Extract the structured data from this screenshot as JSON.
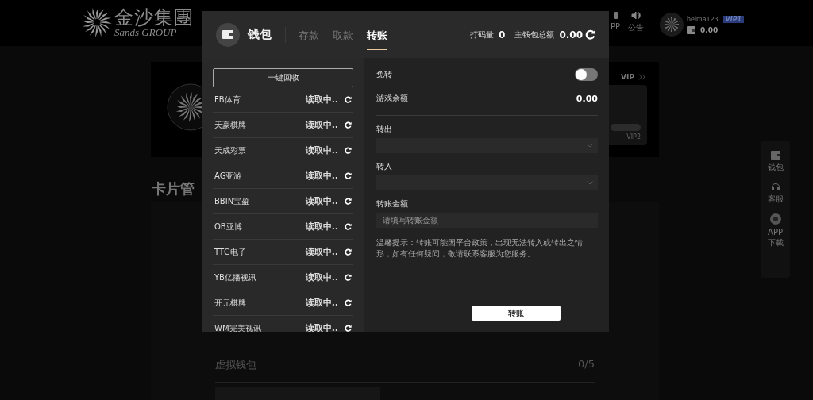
{
  "header": {
    "logo_cn": "金沙集團",
    "logo_en": "Sands GROUP",
    "nav": [
      {
        "label": "PP"
      },
      {
        "label": "公告"
      }
    ],
    "user": {
      "name": "heima123",
      "vip": "VIP1",
      "balance": "0.00"
    }
  },
  "profile_card": {
    "vip_link": "VIP",
    "next_level": "VIP2",
    "level": 0
  },
  "section_title": "卡片管",
  "virtual_wallet": {
    "title": "虚拟钱包",
    "count": "0/5"
  },
  "side_menu": [
    {
      "label": "钱包"
    },
    {
      "label": "客服"
    },
    {
      "label": "APP 下載"
    }
  ],
  "modal": {
    "title": "钱包",
    "tabs": [
      {
        "label": "存款",
        "selected": false
      },
      {
        "label": "取款",
        "selected": false
      },
      {
        "label": "转账",
        "selected": true
      }
    ],
    "bet_label": "打码量",
    "bet": "0",
    "total_label": "主钱包总额",
    "total": "0.00",
    "recall_button": "一键回收",
    "games": [
      {
        "name": "FB体育",
        "status": "读取中.."
      },
      {
        "name": "天豪棋牌",
        "status": "读取中.."
      },
      {
        "name": "天成彩票",
        "status": "读取中.."
      },
      {
        "name": "AG亚游",
        "status": "读取中.."
      },
      {
        "name": "BBIN宝盈",
        "status": "读取中.."
      },
      {
        "name": "OB亚博",
        "status": "读取中.."
      },
      {
        "name": "TTG电子",
        "status": "读取中.."
      },
      {
        "name": "YB亿播视讯",
        "status": "读取中.."
      },
      {
        "name": "开元棋牌",
        "status": "读取中.."
      },
      {
        "name": "WM完美视讯",
        "status": "读取中.."
      }
    ],
    "toggle": {
      "label": "免转",
      "on": false
    },
    "game_balance": {
      "label": "游戏余额",
      "value": "0.00"
    },
    "from": {
      "label": "转出"
    },
    "to": {
      "label": "转入"
    },
    "amount": {
      "label": "转账金额",
      "placeholder": "请填写转账金额"
    },
    "notice": "温馨提示：转账可能因平台政策，出现无法转入或转出之情形，如有任何疑问，敬请联系客服为您服务。",
    "submit": "转账"
  }
}
